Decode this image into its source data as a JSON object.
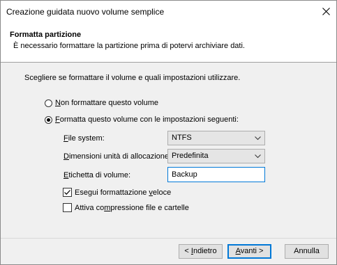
{
  "window": {
    "title": "Creazione guidata nuovo volume semplice"
  },
  "header": {
    "title": "Formatta partizione",
    "subtitle": "È necessario formattare la partizione prima di potervi archiviare dati."
  },
  "body": {
    "instruction": "Scegliere se formattare il volume e quali impostazioni utilizzare.",
    "options": {
      "no_format": {
        "hotkey": "N",
        "label_rest": "on formattare questo volume",
        "checked": false
      },
      "format": {
        "prefix": "",
        "hotkey": "F",
        "label_rest": "ormatta questo volume con le impostazioni seguenti:",
        "checked": true
      }
    },
    "file_system": {
      "hotkey": "F",
      "label_rest": "ile system:",
      "value": "NTFS"
    },
    "allocation": {
      "hotkey": "D",
      "label_rest": "imensioni unità di allocazione:",
      "value": "Predefinita"
    },
    "volume_label": {
      "hotkey": "E",
      "label_rest": "tichetta di volume:",
      "value": "Backup"
    },
    "quick_format": {
      "prefix": "Esegui formattazione ",
      "hotkey": "v",
      "suffix": "eloce",
      "checked": true
    },
    "compression": {
      "prefix": "Attiva co",
      "hotkey": "m",
      "suffix": "pressione file e cartelle",
      "checked": false
    }
  },
  "footer": {
    "back": {
      "prefix": "< ",
      "hotkey": "I",
      "suffix": "ndietro"
    },
    "next": {
      "prefix": "",
      "hotkey": "A",
      "suffix": "vanti >"
    },
    "cancel": {
      "label": "Annulla"
    }
  },
  "colors": {
    "focus_border": "#0078d7",
    "body_bg": "#f0f0f0"
  }
}
